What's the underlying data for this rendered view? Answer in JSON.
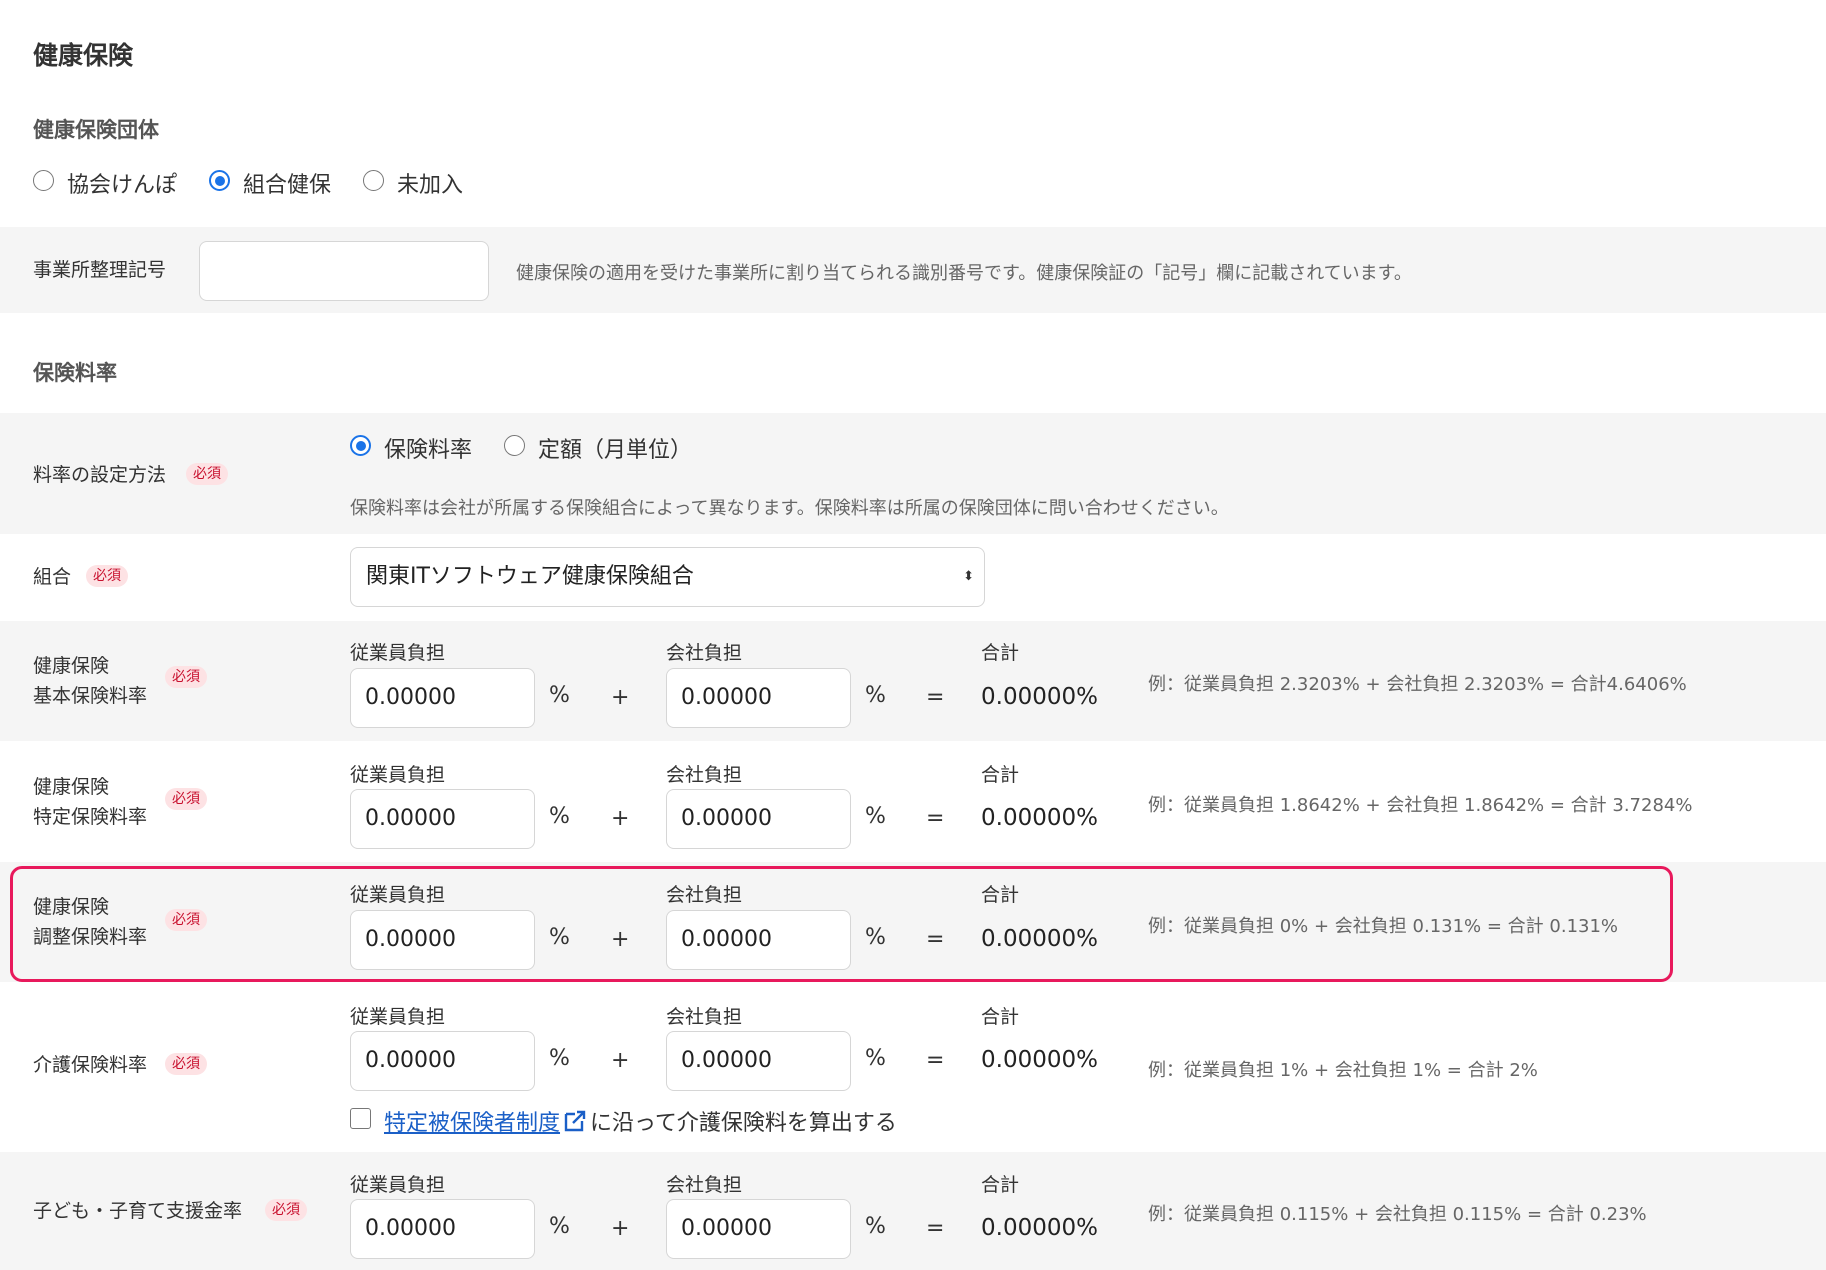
{
  "page": {
    "title": "健康保険"
  },
  "health_group": {
    "label": "健康保険団体",
    "options": [
      "協会けんぽ",
      "組合健保",
      "未加入"
    ],
    "selected": "組合健保"
  },
  "office_code": {
    "label": "事業所整理記号",
    "value": "",
    "hint": "健康保険の適用を受けた事業所に割り当てられる識別番号です。健康保険証の「記号」欄に記載されています。"
  },
  "rate_section": {
    "title": "保険料率"
  },
  "required_badge": "必須",
  "rate_method": {
    "label": "料率の設定方法",
    "options": [
      "保険料率",
      "定額（月単位）"
    ],
    "selected": "保険料率",
    "hint": "保険料率は会社が所属する保険組合によって異なります。保険料率は所属の保険団体に問い合わせください。"
  },
  "union": {
    "label": "組合",
    "value": "関東ITソフトウェア健康保険組合"
  },
  "columns": {
    "employee": "従業員負担",
    "company": "会社負担",
    "total": "合計"
  },
  "symbols": {
    "percent": "%",
    "plus": "+",
    "equals": "="
  },
  "rates": [
    {
      "label_1": "健康保険",
      "label_2": "基本保険料率",
      "employee": "0.00000",
      "company": "0.00000",
      "total": "0.00000%",
      "example": "例：従業員負担 2.3203% + 会社負担 2.3203% = 合計4.6406%"
    },
    {
      "label_1": "健康保険",
      "label_2": "特定保険料率",
      "employee": "0.00000",
      "company": "0.00000",
      "total": "0.00000%",
      "example": "例：従業員負担 1.8642% + 会社負担 1.8642% = 合計 3.7284%"
    },
    {
      "label_1": "健康保険",
      "label_2": "調整保険料率",
      "employee": "0.00000",
      "company": "0.00000",
      "total": "0.00000%",
      "example": "例：従業員負担 0% + 会社負担 0.131% = 合計 0.131%"
    },
    {
      "label_1": "介護保険料率",
      "label_2": "",
      "employee": "0.00000",
      "company": "0.00000",
      "total": "0.00000%",
      "example": "例：従業員負担 1% + 会社負担 1% = 合計 2%"
    },
    {
      "label_1": "子ども・子育て支援金率",
      "label_2": "",
      "employee": "0.00000",
      "company": "0.00000",
      "total": "0.00000%",
      "example": "例：従業員負担 0.115% + 会社負担 0.115% = 合計 0.23%"
    }
  ],
  "care_checkbox": {
    "link": "特定被保険者制度",
    "text": "に沿って介護保険料を算出する",
    "checked": false
  }
}
